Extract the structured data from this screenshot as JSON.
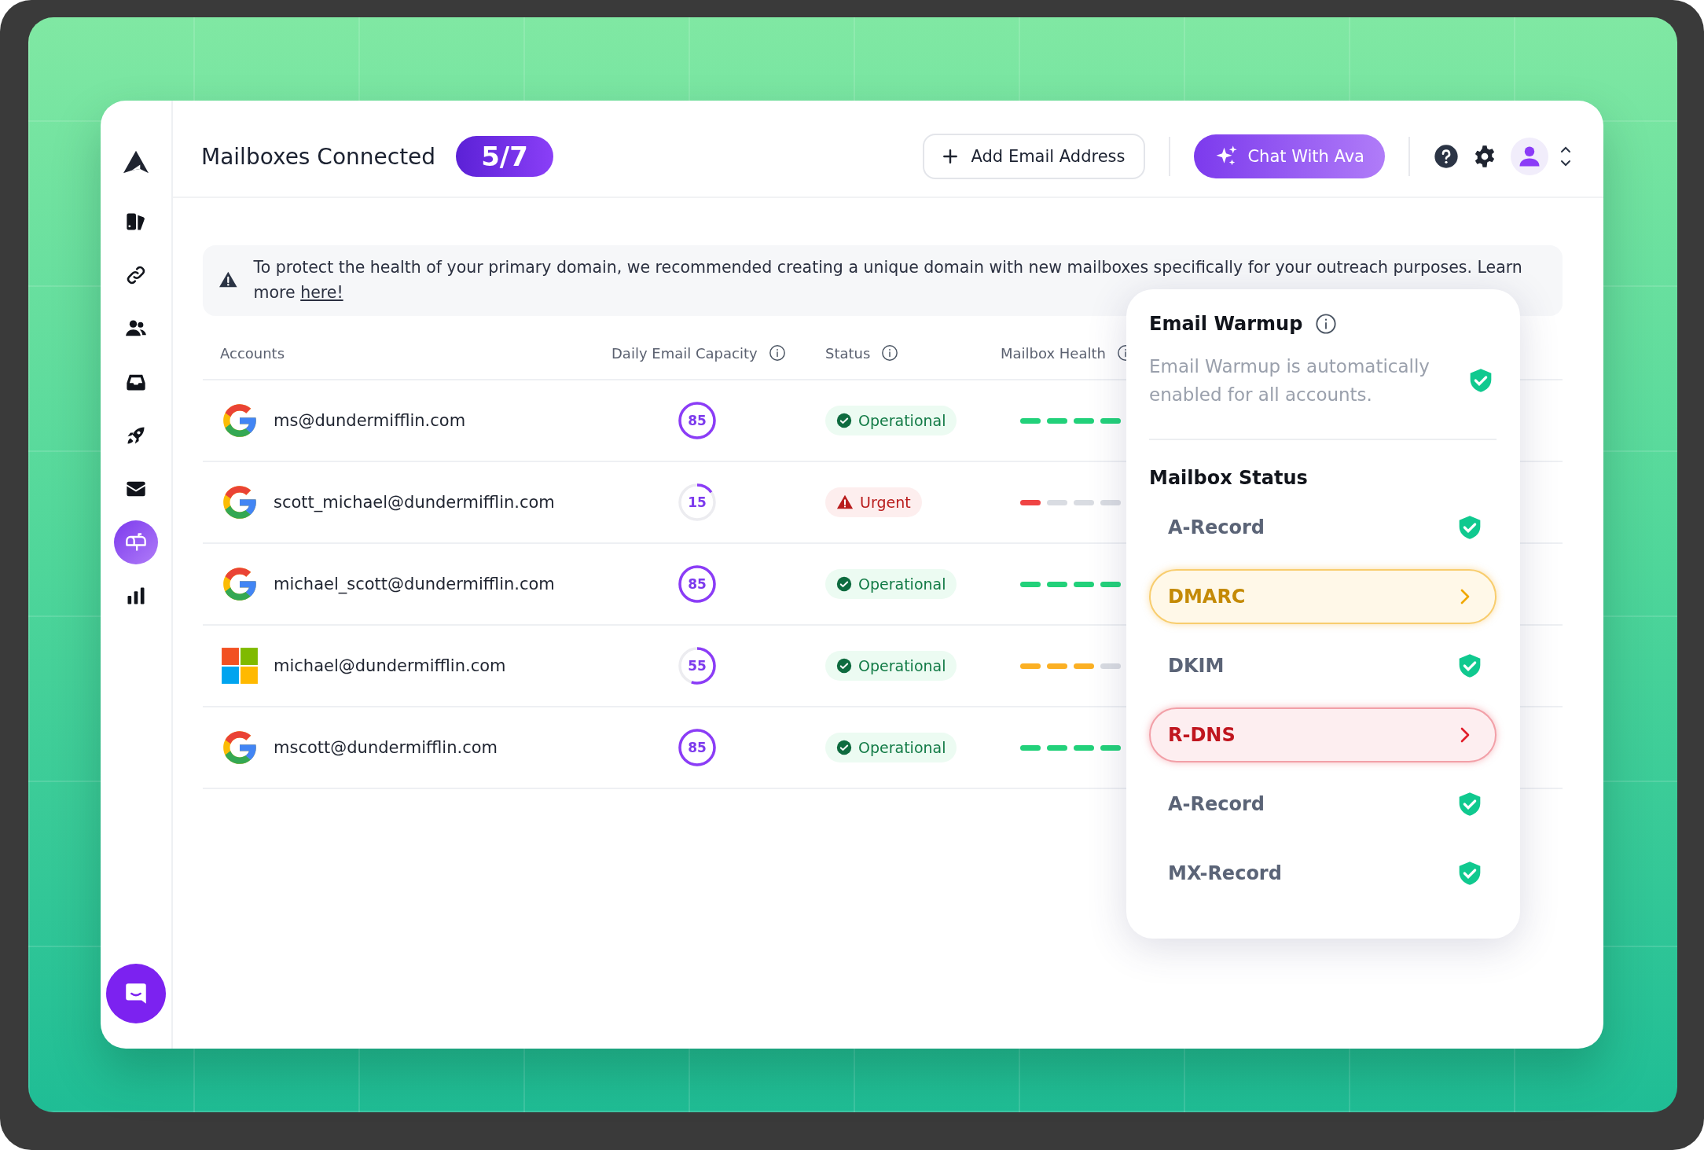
{
  "header": {
    "title": "Mailboxes Connected",
    "count": "5/7",
    "add_button": "Add Email Address",
    "chat_button": "Chat With Ava"
  },
  "sidebar": {
    "items": [
      {
        "selected": false
      },
      {
        "selected": false
      },
      {
        "selected": false
      },
      {
        "selected": false
      },
      {
        "selected": false
      },
      {
        "selected": false
      },
      {
        "selected": true
      },
      {
        "selected": false
      }
    ]
  },
  "banner": {
    "text": "To protect the health of your primary domain, we recommended creating a unique domain with new mailboxes specifically for your outreach purposes. Learn more",
    "link": "here!"
  },
  "table": {
    "columns": [
      "Accounts",
      "Daily Email Capacity",
      "Status",
      "Mailbox Health"
    ],
    "rows": [
      {
        "kind": "google",
        "email": "ms@dundermifflin.com",
        "capacity": {
          "value": "85",
          "level": 1
        },
        "status": {
          "kind": "operational",
          "label": "Operational"
        },
        "health": {
          "stars": 4,
          "color": "#22d17a"
        }
      },
      {
        "kind": "google",
        "email": "scott_michael@dundermifflin.com",
        "capacity": {
          "value": "15",
          "level": 0.15
        },
        "status": {
          "kind": "urgent",
          "label": "Urgent"
        },
        "health": {
          "stars": 1,
          "color": "#ef4444"
        }
      },
      {
        "kind": "google",
        "email": "michael_scott@dundermifflin.com",
        "capacity": {
          "value": "85",
          "level": 1
        },
        "status": {
          "kind": "operational",
          "label": "Operational"
        },
        "health": {
          "stars": 4,
          "color": "#22d17a"
        }
      },
      {
        "kind": "microsoft",
        "email": "michael@dundermifflin.com",
        "capacity": {
          "value": "55",
          "level": 0.55
        },
        "status": {
          "kind": "operational",
          "label": "Operational"
        },
        "health": {
          "stars": 3,
          "color": "#fbb024"
        }
      },
      {
        "kind": "google",
        "email": "mscott@dundermifflin.com",
        "capacity": {
          "value": "85",
          "level": 1
        },
        "status": {
          "kind": "operational",
          "label": "Operational"
        },
        "health": {
          "stars": 4,
          "color": "#22d17a"
        }
      }
    ]
  },
  "popover": {
    "title": "Email Warmup",
    "description": "Email Warmup is automatically enabled for all accounts.",
    "section": "Mailbox Status",
    "items": [
      {
        "label": "A-Record",
        "kind": "ok"
      },
      {
        "label": "DMARC",
        "kind": "warning"
      },
      {
        "label": "DKIM",
        "kind": "ok"
      },
      {
        "label": "R-DNS",
        "kind": "error"
      },
      {
        "label": "A-Record",
        "kind": "ok"
      },
      {
        "label": "MX-Record",
        "kind": "ok"
      }
    ]
  }
}
